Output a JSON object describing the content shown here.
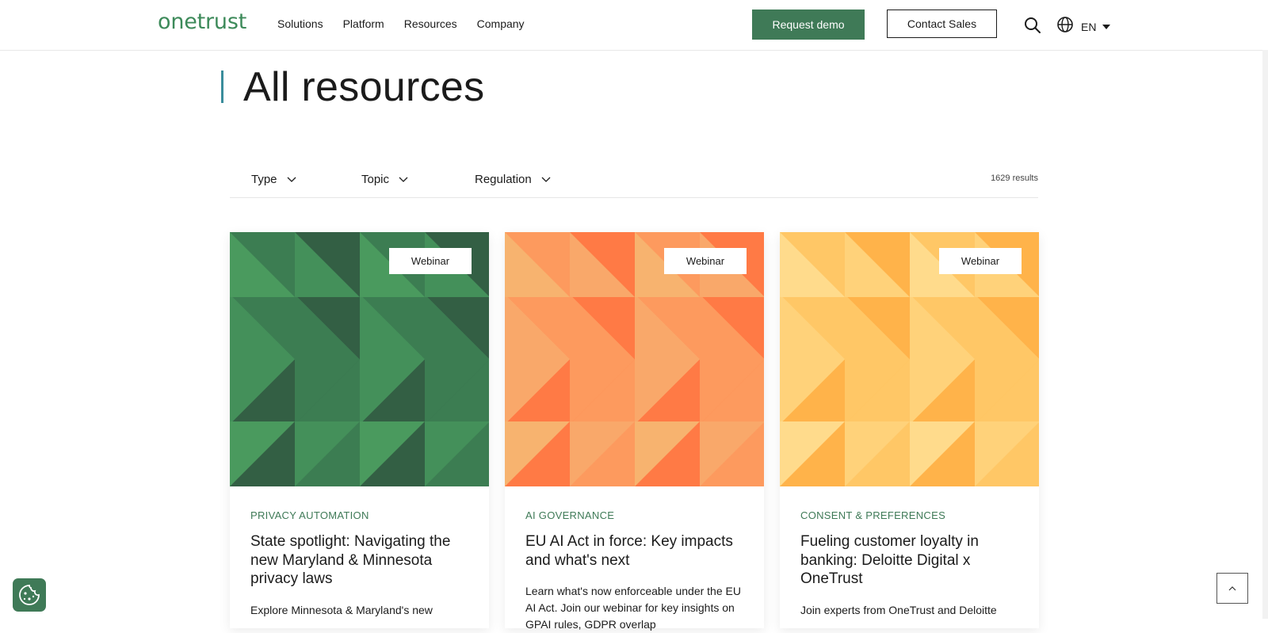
{
  "brand": {
    "logo_text": "onetrust",
    "accent": "#3f7a57",
    "teal": "#3a8d9c"
  },
  "nav": {
    "items": [
      "Solutions",
      "Platform",
      "Resources",
      "Company"
    ],
    "request_demo": "Request demo",
    "contact_sales": "Contact Sales",
    "search_icon": "search-icon",
    "language": "EN"
  },
  "page": {
    "title": "All resources"
  },
  "filters": {
    "type": "Type",
    "topic": "Topic",
    "regulation": "Regulation",
    "results": "1629 results"
  },
  "cards": [
    {
      "badge": "Webinar",
      "category": "PRIVACY AUTOMATION",
      "title": "State spotlight: Navigating the new Maryland & Minnesota privacy laws",
      "description": "Explore Minnesota & Maryland's new",
      "palette": [
        "#4a9a5e",
        "#3c7d52",
        "#335f44",
        "#44905a"
      ]
    },
    {
      "badge": "Webinar",
      "category": "AI GOVERNANCE",
      "title": "EU AI Act in force: Key impacts and what's next",
      "description": "Learn what's now enforceable under the EU AI Act. Join our webinar for key insights on GPAI rules, GDPR overlap",
      "palette": [
        "#f7b36f",
        "#fd9a5e",
        "#ff7a45",
        "#f9a86a"
      ]
    },
    {
      "badge": "Webinar",
      "category": "CONSENT & PREFERENCES",
      "title": "Fueling customer loyalty in banking: Deloitte Digital x OneTrust",
      "description": "Join experts from OneTrust and Deloitte",
      "palette": [
        "#ffdb8c",
        "#ffc766",
        "#ffb34a",
        "#ffd27a"
      ]
    }
  ]
}
